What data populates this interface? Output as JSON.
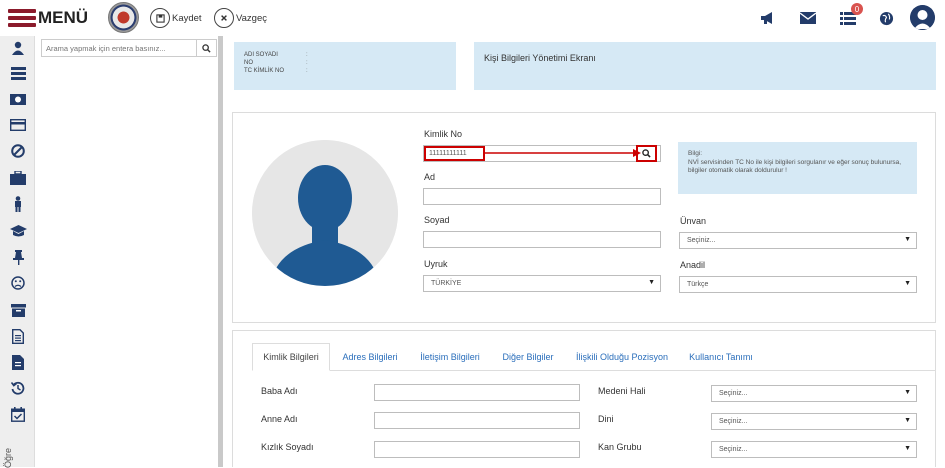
{
  "header": {
    "menu_label": "MENÜ",
    "save_label": "Kaydet",
    "cancel_label": "Vazgeç",
    "notification_count": "0"
  },
  "sidebar": {
    "search_placeholder": "Arama yapmak için entera basınız...",
    "vertical_label": "Öğre",
    "icons": [
      "user-icon",
      "list-icon",
      "money-icon",
      "card-icon",
      "ban-icon",
      "briefcase-icon",
      "person-icon",
      "graduation-cap-icon",
      "pin-icon",
      "frown-icon",
      "archive-icon",
      "document-icon",
      "file-icon",
      "history-icon",
      "calendar-check-icon"
    ]
  },
  "info_panel": {
    "lines": [
      "ADI SOYADI",
      "NO",
      "TC KİMLİK NO"
    ],
    "separators": [
      ":",
      ":",
      ":"
    ]
  },
  "screen_title": "Kişi Bilgileri Yönetimi Ekranı",
  "form": {
    "kimlik_no_label": "Kimlik No",
    "kimlik_no_value": "11111111111",
    "ad_label": "Ad",
    "soyad_label": "Soyad",
    "uyruk_label": "Uyruk",
    "uyruk_value": "TÜRKİYE",
    "unvan_label": "Ünvan",
    "unvan_value": "Seçiniz...",
    "anadil_label": "Anadil",
    "anadil_value": "Türkçe",
    "hint_title": "Bilgi:",
    "hint_text": "NVİ servisinden TC No ile kişi bilgileri sorgulanır ve eğer sonuç bulunursa, bilgiler otomatik olarak doldurulur !"
  },
  "tabs": [
    {
      "label": "Kimlik Bilgileri",
      "active": true
    },
    {
      "label": "Adres Bilgileri",
      "active": false
    },
    {
      "label": "İletişim Bilgileri",
      "active": false
    },
    {
      "label": "Diğer Bilgiler",
      "active": false
    },
    {
      "label": "İlişkili Olduğu Pozisyon",
      "active": false
    },
    {
      "label": "Kullanıcı Tanımı",
      "active": false
    }
  ],
  "identity": {
    "baba_adi_label": "Baba Adı",
    "anne_adi_label": "Anne Adı",
    "kizlik_soyadi_label": "Kızlık Soyadı",
    "medeni_hali_label": "Medeni Hali",
    "medeni_hali_value": "Seçiniz...",
    "dini_label": "Dini",
    "dini_value": "Seçiniz...",
    "kan_grubu_label": "Kan Grubu",
    "kan_grubu_value": "Seçiniz..."
  },
  "colors": {
    "brand": "#8b1a2b",
    "info_bg": "#d6e9f5",
    "tab_link": "#2a6ebb",
    "highlight": "#cc0000",
    "avatar_blue": "#1f5a93"
  }
}
